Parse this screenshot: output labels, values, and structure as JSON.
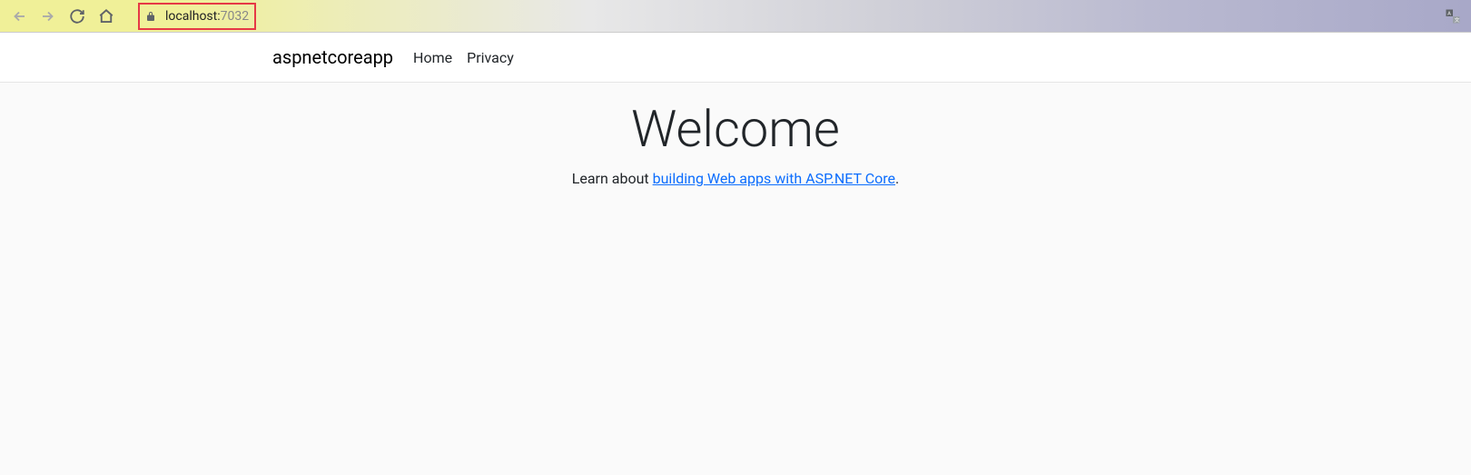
{
  "browser": {
    "url_host": "localhost:",
    "url_port": "7032"
  },
  "navbar": {
    "brand": "aspnetcoreapp",
    "links": [
      "Home",
      "Privacy"
    ]
  },
  "content": {
    "heading": "Welcome",
    "learn_prefix": "Learn about ",
    "learn_link": "building Web apps with ASP.NET Core",
    "learn_suffix": "."
  }
}
